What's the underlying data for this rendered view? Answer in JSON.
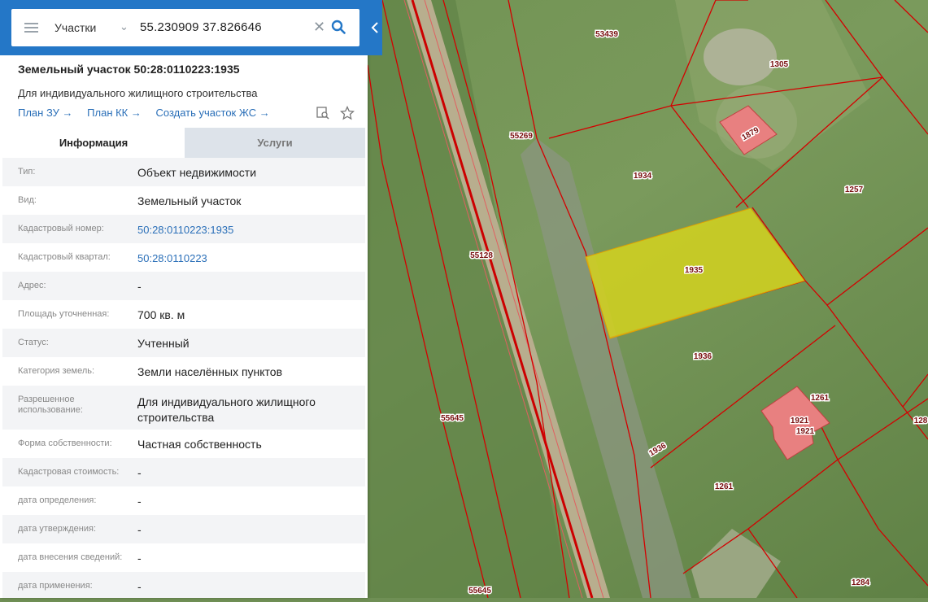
{
  "search": {
    "type_label": "Участки",
    "query": "55.230909 37.826646"
  },
  "parcel": {
    "title": "Земельный участок 50:28:0110223:1935",
    "subtitle": "Для индивидуального жилищного строительства",
    "links": [
      "План ЗУ →",
      "План КК →",
      "Создать участок ЖС →"
    ]
  },
  "tabs": [
    "Информация",
    "Услуги"
  ],
  "rows": [
    {
      "label": "Тип:",
      "value": "Объект недвижимости"
    },
    {
      "label": "Вид:",
      "value": "Земельный участок"
    },
    {
      "label": "Кадастровый номер:",
      "value": "50:28:0110223:1935"
    },
    {
      "label": "Кадастровый квартал:",
      "value": "50:28:0110223"
    },
    {
      "label": "Адрес:",
      "value": "-"
    },
    {
      "label": "Площадь уточненная:",
      "value": "700 кв. м"
    },
    {
      "label": "Статус:",
      "value": "Учтенный"
    },
    {
      "label": "Категория земель:",
      "value": "Земли населённых пунктов"
    },
    {
      "label": "Разрешенное использование:",
      "value": "Для индивидуального жилищного строительства"
    },
    {
      "label": "Форма собственности:",
      "value": "Частная собственность"
    },
    {
      "label": "Кадастровая стоимость:",
      "value": "-"
    },
    {
      "label": "дата определения:",
      "value": "-"
    },
    {
      "label": "дата утверждения:",
      "value": "-"
    },
    {
      "label": "дата внесения сведений:",
      "value": "-"
    },
    {
      "label": "дата применения:",
      "value": "-"
    }
  ],
  "map": {
    "parcel_labels": [
      "53439",
      "1305",
      "55269",
      "1879",
      "1934",
      "1257",
      "55128",
      "1935",
      "1936",
      "1261",
      "1921",
      "1921",
      "55645",
      "1936",
      "1261",
      "128",
      "55645",
      "1284"
    ],
    "selected_parcel_color": "#d4d21e",
    "boundary_color": "#d00000",
    "building_color": "#e88080"
  }
}
